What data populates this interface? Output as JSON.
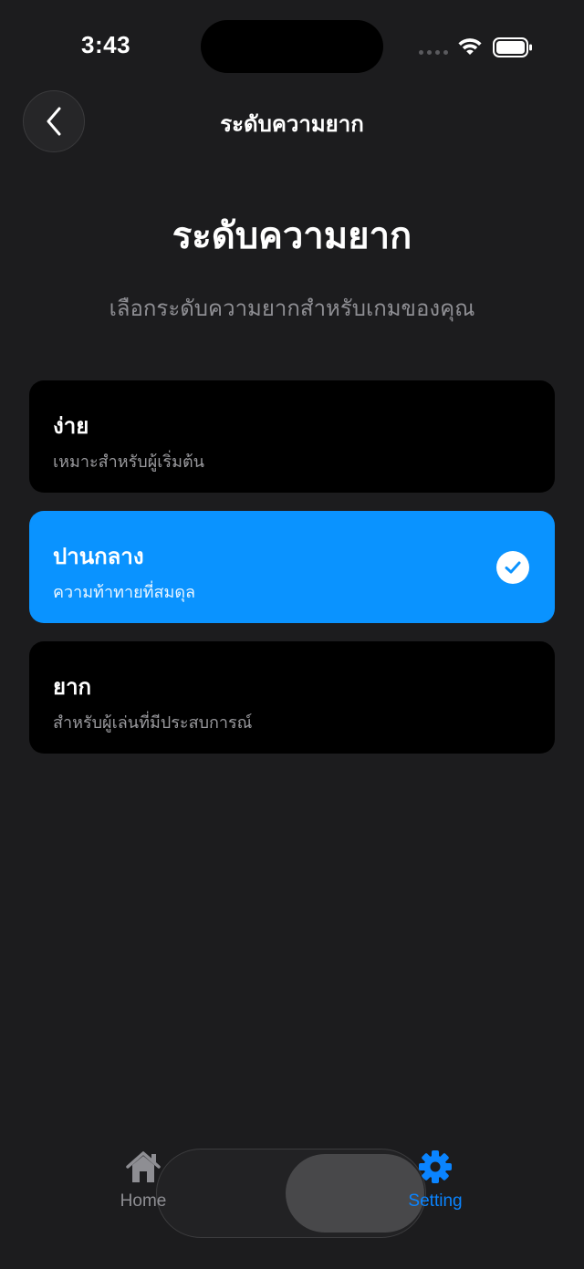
{
  "status_bar": {
    "time": "3:43"
  },
  "nav": {
    "title": "ระดับความยาก"
  },
  "header": {
    "title": "ระดับความยาก",
    "subtitle": "เลือกระดับความยากสำหรับเกมของคุณ"
  },
  "options": [
    {
      "label": "ง่าย",
      "description": "เหมาะสำหรับผู้เริ่มต้น",
      "selected": false
    },
    {
      "label": "ปานกลาง",
      "description": "ความท้าทายที่สมดุล",
      "selected": true
    },
    {
      "label": "ยาก",
      "description": "สำหรับผู้เล่นที่มีประสบการณ์",
      "selected": false
    }
  ],
  "tab_bar": {
    "home_label": "Home",
    "setting_label": "Setting",
    "active_tab": "Setting"
  },
  "colors": {
    "background": "#1c1c1e",
    "accent": "#0a93ff",
    "card": "#000000",
    "secondary_text": "#8e8e93"
  },
  "icons": {
    "back": "chevron-left-icon",
    "check": "checkmark-circle-icon",
    "home": "house-icon",
    "setting": "gear-icon"
  }
}
